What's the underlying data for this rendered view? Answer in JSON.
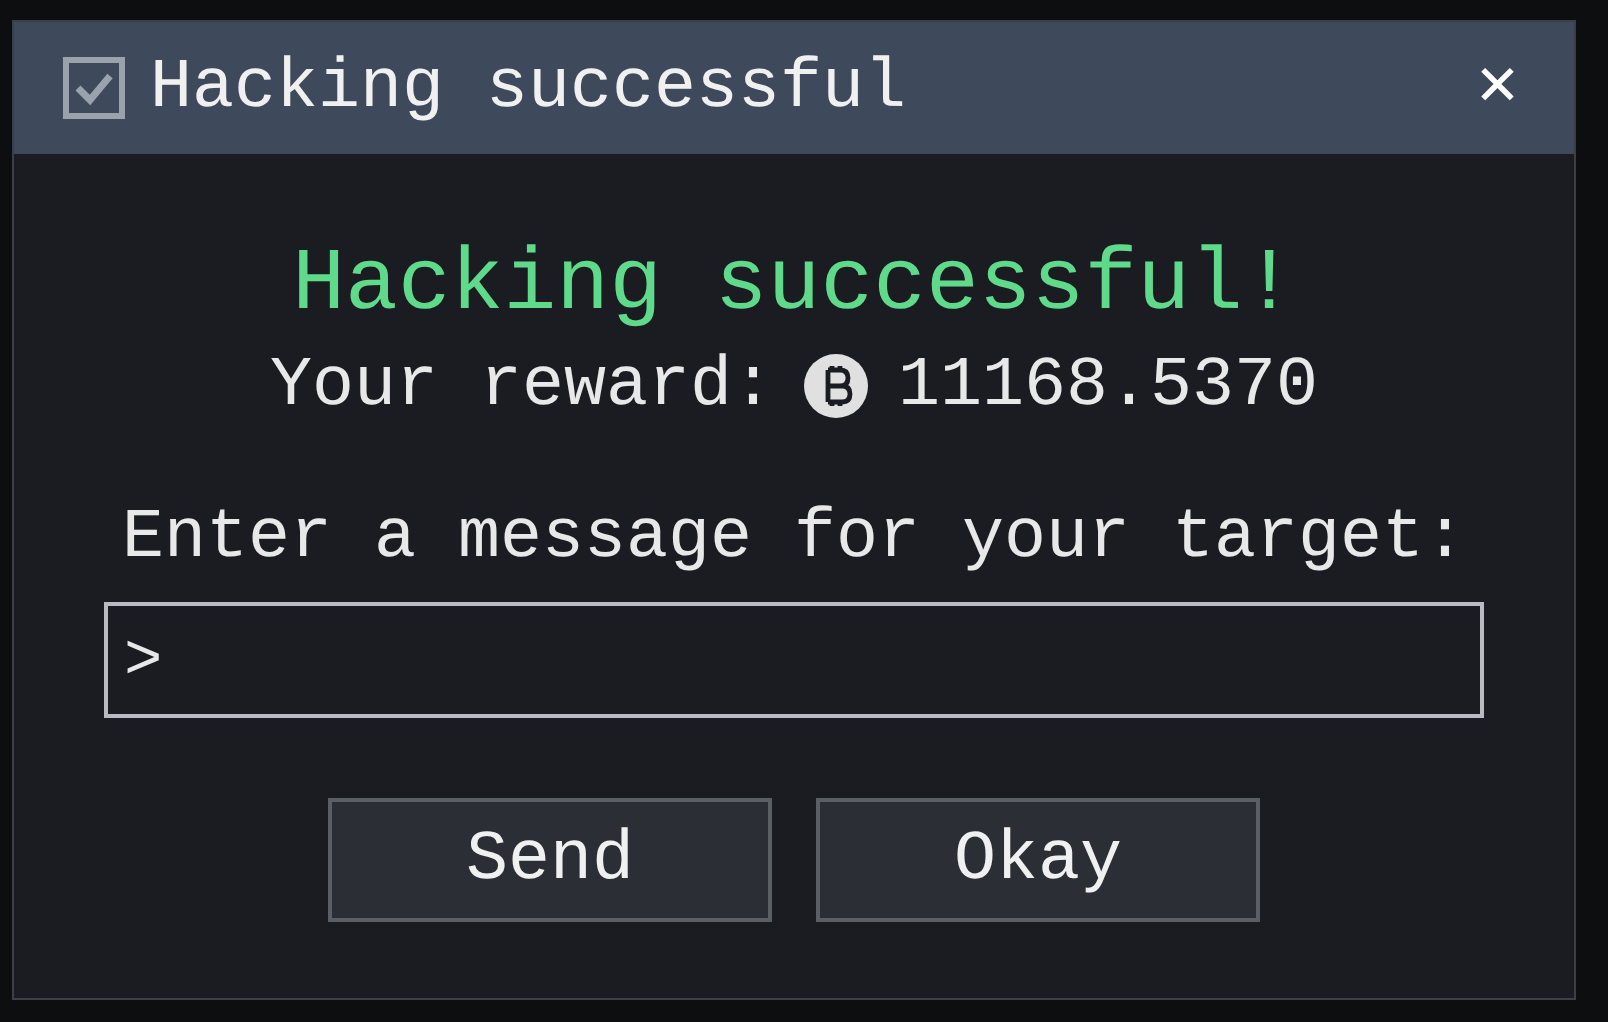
{
  "window": {
    "title": "Hacking successful",
    "close": "✕"
  },
  "heading": "Hacking successful!",
  "reward": {
    "label": "Your reward:",
    "amount": "11168.5370"
  },
  "message": {
    "label": "Enter a message for your target:",
    "value": ">"
  },
  "buttons": [
    "Send",
    "Okay"
  ]
}
